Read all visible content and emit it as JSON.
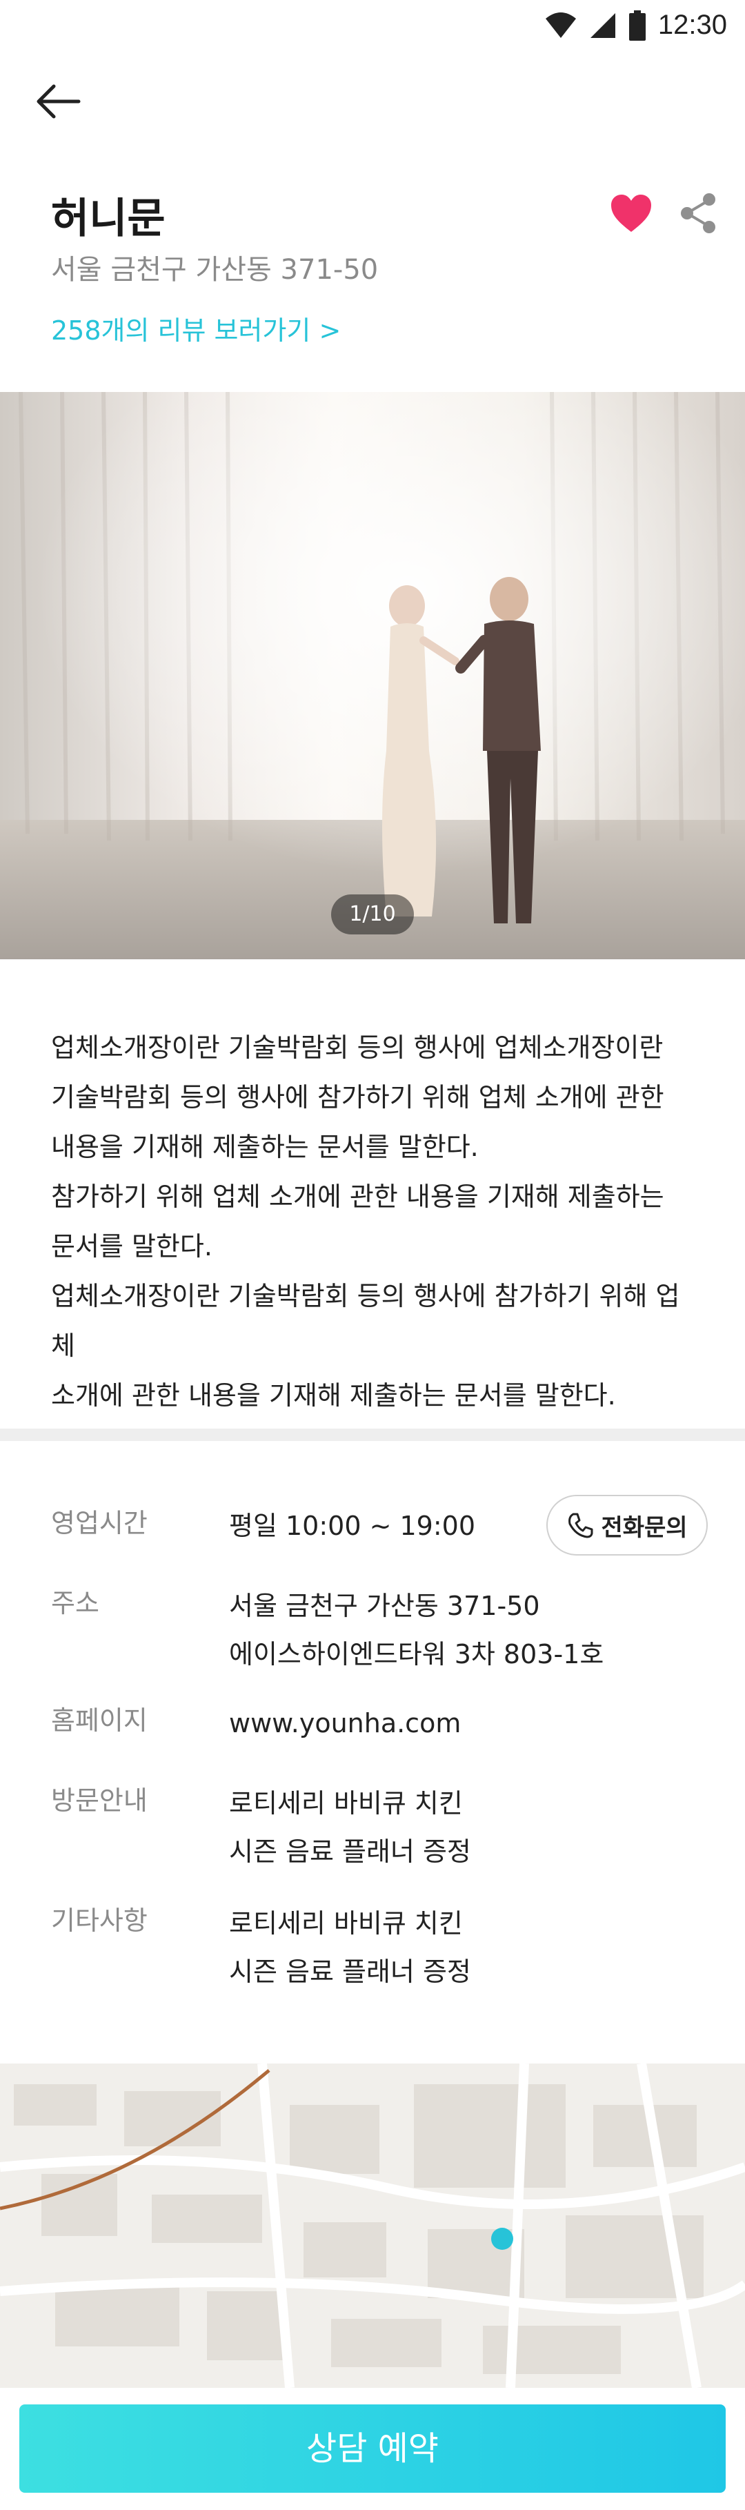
{
  "status_bar": {
    "time": "12:30"
  },
  "header": {
    "back_icon": "arrow-left-icon"
  },
  "venue": {
    "title": "허니문",
    "address": "서울 금천구 가산동 371-50",
    "reviews_link": "258개의 리뷰 보러가기 >",
    "favorite_color": "#f0326a"
  },
  "gallery": {
    "counter": "1/10"
  },
  "description": [
    "업체소개장이란 기술박람회 등의 행사에 업체소개장이란",
    "기술박람회 등의 행사에 참가하기 위해 업체 소개에 관한",
    "내용을 기재해 제출하는 문서를 말한다.",
    "참가하기 위해 업체 소개에 관한 내용을 기재해 제출하는",
    "문서를 말한다.",
    "업체소개장이란 기술박람회 등의 행사에 참가하기 위해 업체",
    "소개에 관한 내용을 기재해 제출하는 문서를 말한다."
  ],
  "info": {
    "hours_label": "영업시간",
    "hours_value": "평일 10:00 ~ 19:00",
    "call_button": "전화문의",
    "address_label": "주소",
    "address_line1": "서울 금천구 가산동 371-50",
    "address_line2": "에이스하이엔드타워 3차 803-1호",
    "homepage_label": "홈페이지",
    "homepage_value": "www.younha.com",
    "visit_label": "방문안내",
    "visit_line1": "로티세리 바비큐 치킨",
    "visit_line2": "시즌 음료 플래너 증정",
    "etc_label": "기타사항",
    "etc_line1": "로티세리 바비큐 치킨",
    "etc_line2": "시즌 음료 플래너 증정"
  },
  "map": {
    "marker_color": "#27c3d8"
  },
  "cta": {
    "label": "상담 예약",
    "accent": "#27d3e3"
  }
}
